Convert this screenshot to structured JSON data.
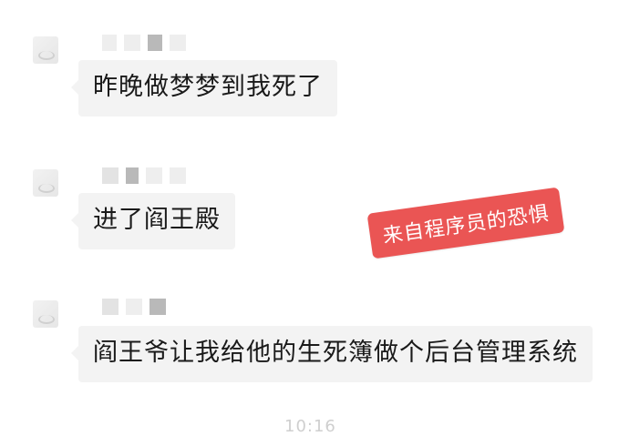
{
  "messages": [
    {
      "text": "昨晚做梦梦到我死了"
    },
    {
      "text": "进了阎王殿"
    },
    {
      "text": "阎王爷让我给他的生死簿做个后台管理系统"
    }
  ],
  "overlay": {
    "stamp_text": "来自程序员的恐惧"
  },
  "timestamp": "10:16",
  "colors": {
    "bubble_bg": "#f3f3f3",
    "stamp_bg": "#ea5554",
    "text": "#1a1a1a"
  }
}
